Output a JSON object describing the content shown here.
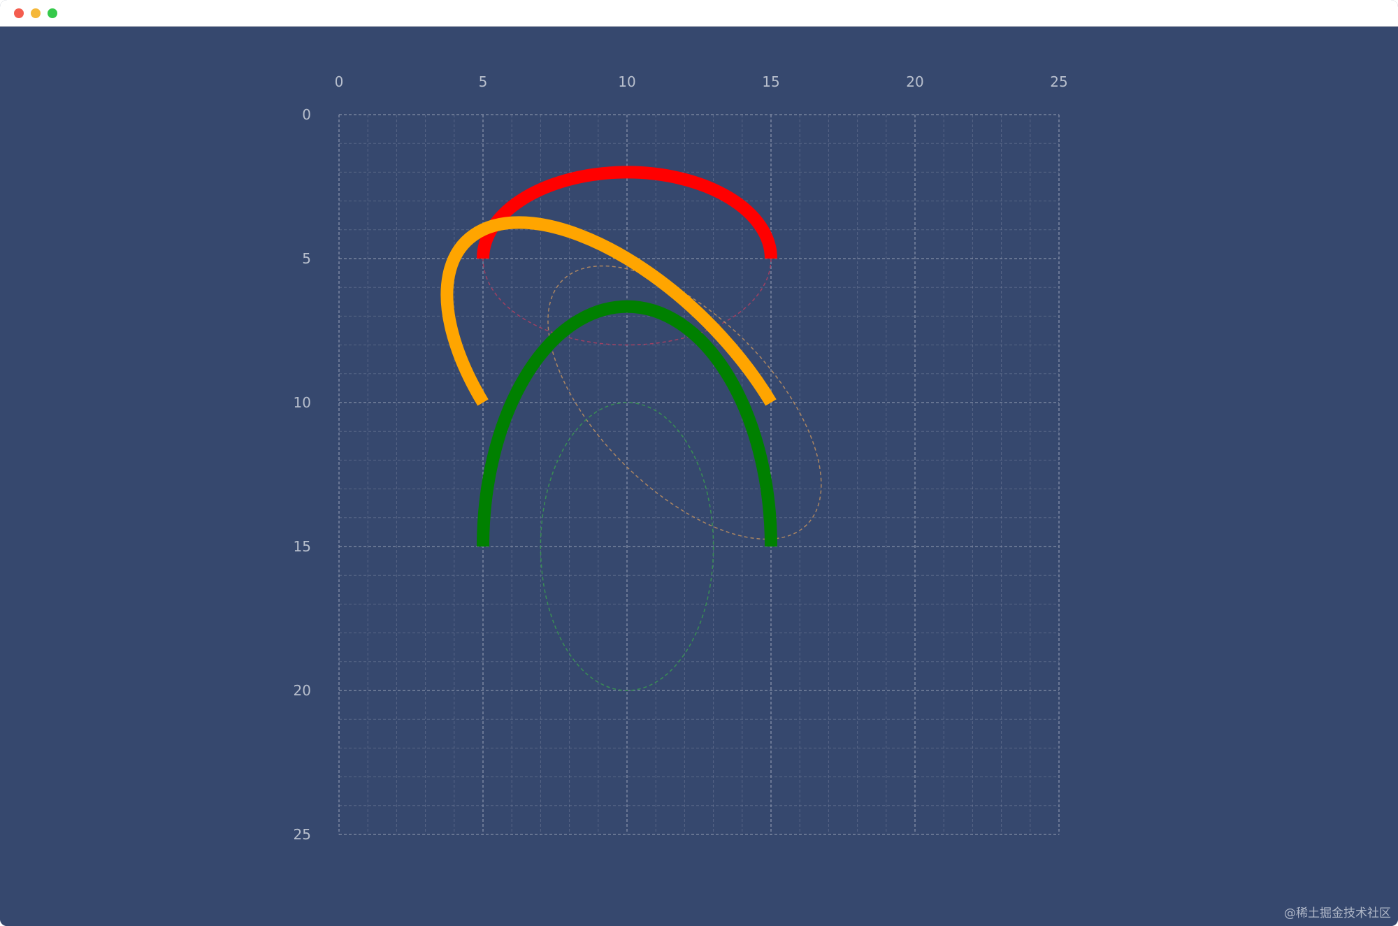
{
  "window": {
    "controls": [
      {
        "name": "close",
        "color": "#f45d4f"
      },
      {
        "name": "minimize",
        "color": "#f5b83a"
      },
      {
        "name": "zoom",
        "color": "#35c94b"
      }
    ]
  },
  "canvas": {
    "background": "#36486e",
    "grid_color": "#8d97ad",
    "label_color": "#b8bfcd",
    "x_min": 0,
    "x_max": 25,
    "y_min": 0,
    "y_max": 25,
    "minor_step": 1,
    "major_step": 5,
    "x_tick_labels": [
      "0",
      "5",
      "10",
      "15",
      "20",
      "25"
    ],
    "y_tick_labels": [
      "0",
      "5",
      "10",
      "15",
      "20",
      "25"
    ]
  },
  "arcs": [
    {
      "name": "red",
      "color": "#ff0000",
      "center": [
        10,
        5
      ],
      "rx": 5,
      "ry": 3,
      "rotation": 0,
      "start": [
        5,
        5
      ],
      "end": [
        15,
        5
      ],
      "guide_color": "#b04060"
    },
    {
      "name": "orange",
      "color": "#ffa500",
      "center": [
        12,
        10
      ],
      "rx": 6,
      "ry": 3,
      "rotation": 45,
      "start": [
        5,
        10
      ],
      "end": [
        15,
        10
      ],
      "guide_color": "#c09060"
    },
    {
      "name": "green",
      "color": "#008000",
      "center": [
        10,
        15
      ],
      "rx": 3,
      "ry": 5,
      "rotation": 0,
      "start": [
        5,
        15
      ],
      "end": [
        15,
        15
      ],
      "guide_color": "#3a9a50"
    }
  ],
  "watermark": "@稀土掘金技术社区"
}
